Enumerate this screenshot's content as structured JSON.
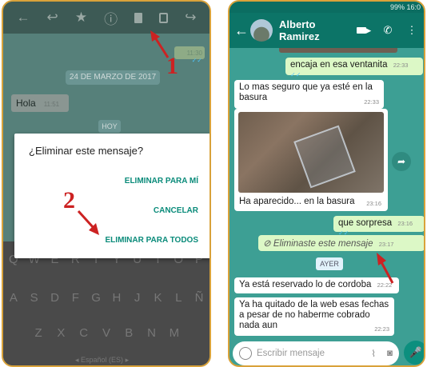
{
  "left_phone": {
    "outgoing_time": "11:30",
    "date_chip": "24 DE MARZO DE 2017",
    "hola_text": "Hola",
    "hola_time": "11:51",
    "today_chip": "HOY",
    "dialog": {
      "title": "¿Eliminar este mensaje?",
      "delete_for_me": "ELIMINAR PARA MÍ",
      "cancel": "CANCELAR",
      "delete_for_all": "ELIMINAR PARA TODOS"
    },
    "keyboard": {
      "row1": [
        "Q",
        "W",
        "E",
        "R",
        "T",
        "Y",
        "U",
        "I",
        "O",
        "P"
      ],
      "row2": [
        "A",
        "S",
        "D",
        "F",
        "G",
        "H",
        "J",
        "K",
        "L",
        "Ñ"
      ],
      "row3": [
        "Z",
        "X",
        "C",
        "V",
        "B",
        "N",
        "M"
      ],
      "language": "Español (ES)"
    },
    "step_numbers": [
      "1",
      "2"
    ]
  },
  "right_phone": {
    "status": "99% 16:0",
    "contact_name": "Alberto Ramirez",
    "messages": [
      {
        "dir": "out",
        "text": "encaja en esa ventanita",
        "time": "22:33"
      },
      {
        "dir": "in",
        "text": "Lo mas seguro que ya esté en la basura",
        "time": "22:33"
      },
      {
        "dir": "in",
        "text": "Ha aparecido... en la basura",
        "time": "23:16"
      },
      {
        "dir": "out",
        "text": "que sorpresa",
        "time": "23:16"
      },
      {
        "dir": "out",
        "text": "Eliminaste este mensaje",
        "time": "23:17"
      },
      {
        "dir": "in",
        "text": "Ya está reservado lo de cordoba",
        "time": "22:22"
      },
      {
        "dir": "in",
        "text": "Ya ha quitado de la web esas fechas a pesar de no haberme cobrado nada aun",
        "time": "22:23"
      }
    ],
    "day_chip": "AYER",
    "compose_placeholder": "Escribir mensaje"
  },
  "colors": {
    "frame": "#d9a23a",
    "whatsapp_green": "#0c7467",
    "dialog_action": "#0a8b7a",
    "arrow_red": "#cc2222"
  }
}
